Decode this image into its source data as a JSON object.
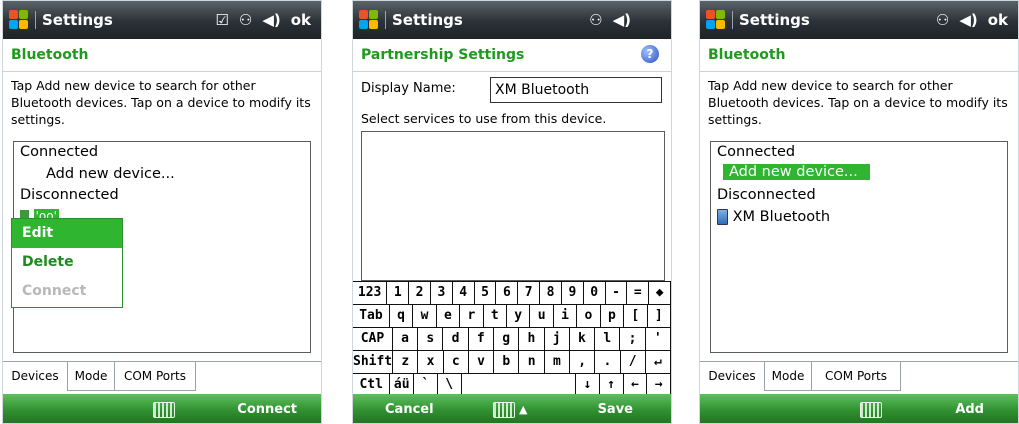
{
  "screens": [
    {
      "title": "Settings",
      "tray": {
        "ok": "ok"
      },
      "heading": "Bluetooth",
      "description": "Tap Add new device to search for other Bluetooth devices. Tap on a device to modify its settings.",
      "list": {
        "connected": "Connected",
        "add": "Add new device...",
        "disconnected": "Disconnected",
        "device": "'oo'"
      },
      "menu": [
        "Edit",
        "Delete",
        "Connect"
      ],
      "tabs": [
        "Devices",
        "Mode",
        "COM Ports"
      ],
      "softkeys": {
        "right": "Connect"
      }
    },
    {
      "title": "Settings",
      "heading": "Partnership Settings",
      "help": "?",
      "display_label": "Display Name:",
      "display_value": "XM Bluetooth",
      "services_label": "Select services to use from this device.",
      "softkeys": {
        "left": "Cancel",
        "right": "Save"
      },
      "keyboard_rows": [
        [
          "123",
          "1",
          "2",
          "3",
          "4",
          "5",
          "6",
          "7",
          "8",
          "9",
          "0",
          "-",
          "=",
          "◆"
        ],
        [
          "Tab",
          "q",
          "w",
          "e",
          "r",
          "t",
          "y",
          "u",
          "i",
          "o",
          "p",
          "[",
          "]"
        ],
        [
          "CAP",
          "a",
          "s",
          "d",
          "f",
          "g",
          "h",
          "j",
          "k",
          "l",
          ";",
          "'"
        ],
        [
          "Shift",
          "z",
          "x",
          "c",
          "v",
          "b",
          "n",
          "m",
          ",",
          ".",
          "/",
          "↵"
        ],
        [
          "Ctl",
          "áü",
          "`",
          "\\",
          " ",
          "↓",
          "↑",
          "←",
          "→"
        ]
      ]
    },
    {
      "title": "Settings",
      "tray": {
        "ok": "ok"
      },
      "heading": "Bluetooth",
      "description": "Tap Add new device to search for other Bluetooth devices. Tap on a device to modify its settings.",
      "list": {
        "connected": "Connected",
        "add": "Add new device...",
        "disconnected": "Disconnected",
        "device": "XM Bluetooth"
      },
      "tabs": [
        "Devices",
        "Mode",
        "COM Ports"
      ],
      "softkeys": {
        "right": "Add"
      }
    }
  ],
  "colors": {
    "accent": "#1f9a1f",
    "softbar": "#2f8f2f",
    "titlebar": "#2b3136",
    "highlight": "#2fb52f"
  }
}
